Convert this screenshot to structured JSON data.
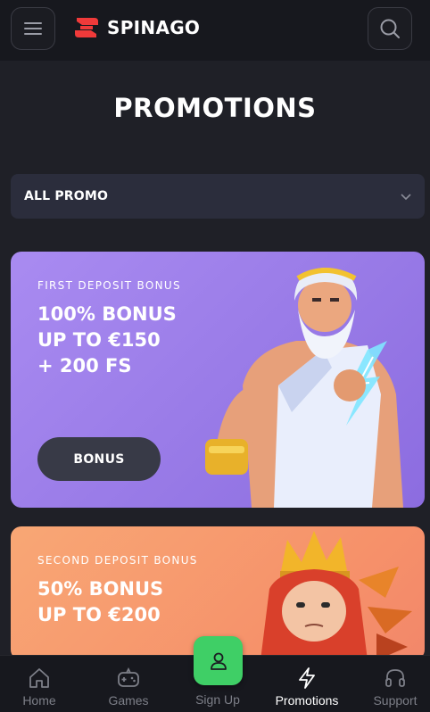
{
  "header": {
    "logo_text": "SPINAGO",
    "menu_icon": "hamburger-menu-icon",
    "search_icon": "search-icon"
  },
  "page": {
    "title": "PROMOTIONS"
  },
  "filter": {
    "selected": "ALL PROMO",
    "icon": "chevron-down-icon"
  },
  "promos": [
    {
      "subtitle": "FIRST DEPOSIT BONUS",
      "title_lines": [
        "100% BONUS",
        "UP TO €150",
        "+ 200 FS"
      ],
      "button_label": "BONUS",
      "color": "#a98bf1"
    },
    {
      "subtitle": "SECOND DEPOSIT BONUS",
      "title_lines": [
        "50% BONUS",
        "UP TO €200"
      ],
      "color": "#f8a775"
    }
  ],
  "bottom_nav": {
    "home": "Home",
    "games": "Games",
    "signup": "Sign Up",
    "promotions": "Promotions",
    "support": "Support"
  },
  "colors": {
    "accent_green": "#3fcf66",
    "brand_red": "#f03a3a",
    "background": "#1f2027"
  }
}
